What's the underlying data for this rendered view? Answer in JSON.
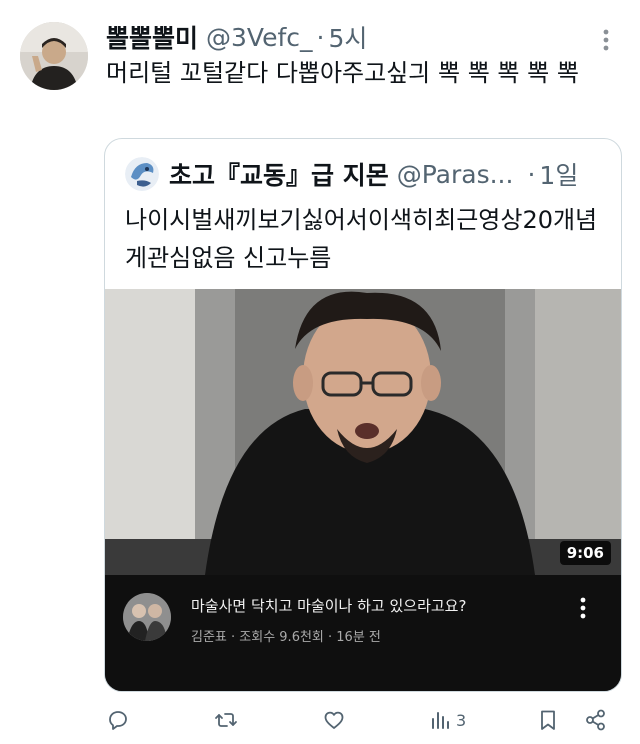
{
  "tweet": {
    "display_name": "뽈뽈뽈미",
    "handle": "@3Vefc_",
    "separator": "·",
    "time": "5시",
    "text": "머리털 꼬털같다 다뽑아주고싶긔 뽁 뽁 뽁 뽁 뽁"
  },
  "quoted": {
    "display_name": "초고『교동』급 지몬",
    "handle": "@Paras...",
    "separator": "·",
    "time": "1일",
    "text": "나이시벌새끼보기싫어서이색히최근영상20개념게관심없음 신고누름",
    "video": {
      "duration": "9:06",
      "title": "마술사면 닥치고 마술이나 하고 있으라고요?",
      "meta": "김준표 · 조회수 9.6천회 · 16분 전"
    }
  },
  "actions": {
    "views_count": "3"
  },
  "icons": {
    "reply": "reply-icon",
    "retweet": "retweet-icon",
    "like": "heart-icon",
    "views": "views-icon",
    "bookmark": "bookmark-icon",
    "share": "share-icon",
    "more": "more-vertical-icon"
  }
}
